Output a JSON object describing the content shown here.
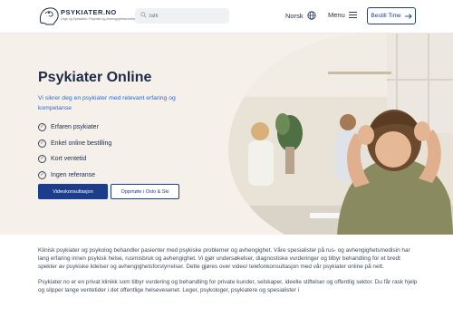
{
  "header": {
    "brand_name": "PSYKIATER.NO",
    "brand_tagline": "Lege og Spesialist i Psykiatri og Avhengighetsmedisin",
    "search_placeholder": "Søk",
    "language_label": "Norsk",
    "menu_label": "Menu",
    "book_button_label": "Bestill Time",
    "icons": [
      "logo-head",
      "search-icon",
      "globe-icon",
      "hamburger-icon",
      "arrow-right-icon"
    ]
  },
  "hero": {
    "title": "Psykiater Online",
    "subtitle": "Vi sikrer deg en psykiater med relevant erfaring og kompetanse",
    "features": [
      "Erfaren psykiater",
      "Enkel online bestilling",
      "Kort ventetid",
      "Ingen referanse"
    ],
    "primary_button": "Videokonsultasjon",
    "secondary_button": "Oppmøte i Oslo & Ski"
  },
  "content": {
    "paragraph_1": "Klinisk psykiater og psykolog behandler pasienter med psykiske problemer og avhengighet. Våre spesialister på rus- og avhengighetsmedisin har lang erfaring innen psykisk helse, rusmisbruk og avhengighet. Vi gjør undersøkelser, diagnostiske vurderinger og tilbyr behandling for et bredt spekter av psykiske lidelser og avhengighetsforstyrrelser. Dette gjøres over video/ telefonkonsultasjon med vår psykiater online på nett.",
    "paragraph_2": "Psykiater.no er en privat klinikk som tilbyr vurdering og behandling for private kunder, selskaper, ideelle stiftelser og offentlig sektor. Du får rask hjelp og slipper lange ventetider i det offentlige helsevesenet. Leger, psykologer, psykiatere og spesialister i"
  },
  "colors": {
    "navy": "#1c3d8c",
    "text_dark": "#1c2b4a",
    "accent_blue": "#2e6ad1",
    "hero_bg": "#f5f1ea"
  }
}
